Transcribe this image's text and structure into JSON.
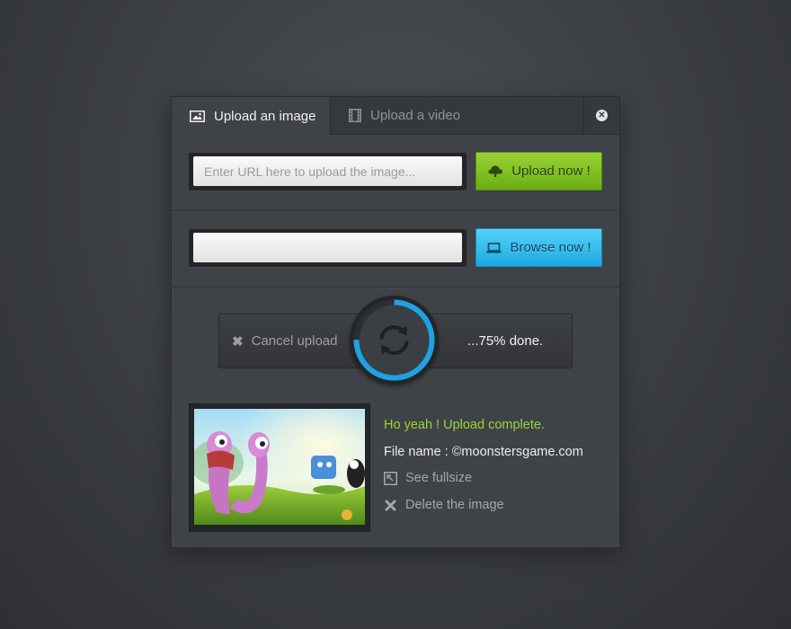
{
  "tabs": {
    "image_label": "Upload an image",
    "video_label": "Upload a video",
    "close_glyph": "✕"
  },
  "url_upload": {
    "placeholder": "Enter URL here to upload the image...",
    "value": "",
    "button_label": "Upload now !",
    "button_icon": "cloud-upload-icon",
    "button_color": "#7fbf22"
  },
  "file_browse": {
    "value": "",
    "button_label": "Browse now !",
    "button_icon": "laptop-icon",
    "button_color": "#31bdec"
  },
  "progress": {
    "cancel_label": "Cancel upload",
    "cancel_glyph": "✖",
    "status_text": "...75% done.",
    "percent": 75,
    "ring_color": "#1ea2e3"
  },
  "result": {
    "success_text": "Ho yeah ! Upload complete.",
    "filename_text": "File name : ©moonstersgame.com",
    "fullsize_label": "See fullsize",
    "delete_label": "Delete the image",
    "success_color": "#9ad43a"
  }
}
